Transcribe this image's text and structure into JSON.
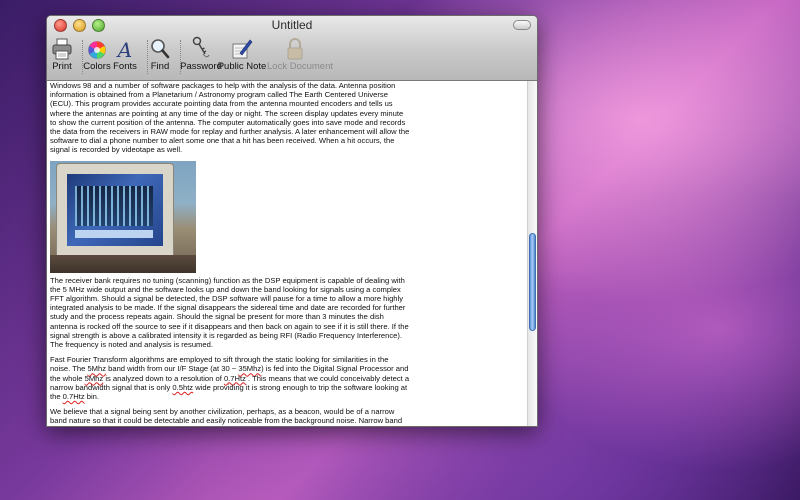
{
  "window": {
    "title": "Untitled"
  },
  "toolbar": {
    "print": "Print",
    "colors": "Colors",
    "fonts": "Fonts",
    "find": "Find",
    "password": "Password",
    "public_note": "Public Note",
    "lock_document": "Lock Document"
  },
  "document": {
    "para1": "Windows 98 and a number of software packages to help with the analysis of the data. Antenna position information is obtained from a Planetarium / Astronomy program called The Earth Centered Universe (ECU). This program provides accurate pointing data from the antenna mounted encoders and tells us where the antennas are pointing at any time of the day or night. The screen display updates every minute to show the current position of the antenna. The computer automatically goes into save mode and records the data from the receivers in RAW mode for replay and further analysis. A later enhancement will allow the software to dial a phone number to alert some one that a hit has been received. When a hit occurs, the signal is recorded by videotape as well.",
    "para2": "The receiver bank requires no tuning (scanning) function as the DSP equipment is capable of dealing with the 5 MHz wide output and the software looks up and down the band looking for signals using a complex FFT algorithm. Should a signal be detected, the DSP software will pause for a time to allow a more highly integrated analysis to be made. If the signal disappears the sidereal time and date are recorded for further study and the process repeats again. Should the signal be present for more than 3 minutes the dish antenna is rocked off the source to see if it disappears and then back on again to see if it is still there. If the signal strength is above a calibrated intensity it is regarded as being RFI (Radio Frequency Interference). The frequency is noted and analysis is resumed.",
    "para3": {
      "s1": "Fast Fourier Transform algorithms are employed to sift through the static looking for similarities in the noise. The ",
      "w1": "5Mhz",
      "s2": " band width from our I/F Stage (at 30 ~ ",
      "w2": "35Mhz",
      "s3": ") is fed into the Digital Signal Processor and the whole ",
      "w3": "5Mhz",
      "s4": " is analyzed down to a resolution of ",
      "w4": "0.7Htz",
      "s5": " . This means that we could conceivably detect a narrow bandwidth signal that is only ",
      "w5": "0.5htz",
      "s6": " wide providing it is strong enough to trip the software looking at the ",
      "w6": "0.7Htz",
      "s7": " bin."
    },
    "para4": "We believe that a signal being sent by another civilization, perhaps, as a beacon, would be of a narrow band nature so that it could be detectable and easily noticeable from the background noise. Narrow band signals are not likely to be created by naturally occurring processes and as such, would have a high probability of being artificially manufactured. Our Project Argus Stations are capable of detecting a signal out to about 100 light years depending upon the nature of the transmitting antenna and transmitter power.  Civilizations further away from us will be more difficult to detect, as the signals being transmitted would need to be extremely powerful and highly"
  },
  "icons": {
    "print": "printer-icon",
    "colors": "color-wheel-icon",
    "fonts": "fonts-icon",
    "find": "magnifier-icon",
    "password": "key-icon",
    "public_note": "note-pen-icon",
    "lock_document": "padlock-icon"
  }
}
